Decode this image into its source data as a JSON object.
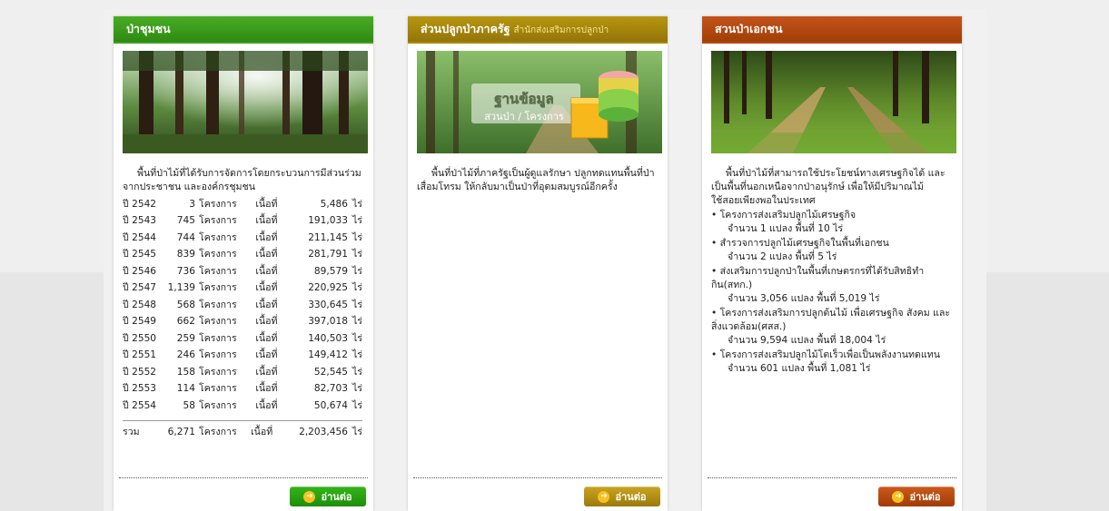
{
  "colors": {
    "community_green": "#3c9a1c",
    "state_gold": "#a8860f",
    "private_rust": "#b3480d"
  },
  "cards": [
    {
      "title": "ป่าชุมชน",
      "image_icon": "forest-photo",
      "description": "พื้นที่ป่าไม้ที่ได้รับการจัดการโดยกระบวนการมีส่วนร่วมจากประชาชน และองค์กรชุมชน",
      "rows": [
        {
          "year": "ปี 2542",
          "count": "3",
          "proj": "โครงการ",
          "area_label": "เนื้อที่",
          "area": "5,486",
          "unit": "ไร่"
        },
        {
          "year": "ปี 2543",
          "count": "745",
          "proj": "โครงการ",
          "area_label": "เนื้อที่",
          "area": "191,033",
          "unit": "ไร่"
        },
        {
          "year": "ปี 2544",
          "count": "744",
          "proj": "โครงการ",
          "area_label": "เนื้อที่",
          "area": "211,145",
          "unit": "ไร่"
        },
        {
          "year": "ปี 2545",
          "count": "839",
          "proj": "โครงการ",
          "area_label": "เนื้อที่",
          "area": "281,791",
          "unit": "ไร่"
        },
        {
          "year": "ปี 2546",
          "count": "736",
          "proj": "โครงการ",
          "area_label": "เนื้อที่",
          "area": "89,579",
          "unit": "ไร่"
        },
        {
          "year": "ปี 2547",
          "count": "1,139",
          "proj": "โครงการ",
          "area_label": "เนื้อที่",
          "area": "220,925",
          "unit": "ไร่"
        },
        {
          "year": "ปี 2548",
          "count": "568",
          "proj": "โครงการ",
          "area_label": "เนื้อที่",
          "area": "330,645",
          "unit": "ไร่"
        },
        {
          "year": "ปี 2549",
          "count": "662",
          "proj": "โครงการ",
          "area_label": "เนื้อที่",
          "area": "397,018",
          "unit": "ไร่"
        },
        {
          "year": "ปี 2550",
          "count": "259",
          "proj": "โครงการ",
          "area_label": "เนื้อที่",
          "area": "140,503",
          "unit": "ไร่"
        },
        {
          "year": "ปี 2551",
          "count": "246",
          "proj": "โครงการ",
          "area_label": "เนื้อที่",
          "area": "149,412",
          "unit": "ไร่"
        },
        {
          "year": "ปี 2552",
          "count": "158",
          "proj": "โครงการ",
          "area_label": "เนื้อที่",
          "area": "52,545",
          "unit": "ไร่"
        },
        {
          "year": "ปี 2553",
          "count": "114",
          "proj": "โครงการ",
          "area_label": "เนื้อที่",
          "area": "82,703",
          "unit": "ไร่"
        },
        {
          "year": "ปี 2554",
          "count": "58",
          "proj": "โครงการ",
          "area_label": "เนื้อที่",
          "area": "50,674",
          "unit": "ไร่"
        }
      ],
      "total": {
        "label": "รวม",
        "count": "6,271",
        "proj": "โครงการ",
        "area_label": "เนื้อที่",
        "area": "2,203,456",
        "unit": "ไร่"
      },
      "button": "อ่านต่อ"
    },
    {
      "title": "ส่วนปลูกป่าภาครัฐ",
      "subtitle": "สำนักส่งเสริมการปลูกป่า",
      "image_icon": "database-forest-photo",
      "image_text_1": "ฐานข้อมูล",
      "image_text_2": "สวนป่า / โครงการ",
      "description": "พื้นที่ป่าไม้ที่ภาครัฐเป็นผู้ดูแลรักษา ปลูกทดแทนพื้นที่ป่าเสื่อมโทรม ให้กลับมาเป็นป่าที่อุดมสมบูรณ์อีกครั้ง",
      "button": "อ่านต่อ"
    },
    {
      "title": "สวนป่าเอกชน",
      "image_icon": "forest-path-photo",
      "description": "พื้นที่ป่าไม้ที่สามารถใช้ประโยชน์ทางเศรษฐกิจได้ และเป็นพื้นที่นอกเหนือจากป่าอนุรักษ์ เพื่อให้มีปริมาณไม้ใช้สอยเพียงพอในประเทศ",
      "items": [
        {
          "line1": "• โครงการส่งเสริมปลูกไม้เศรษฐกิจ",
          "line2": "จำนวน 1 แปลง พื้นที่ 10 ไร่"
        },
        {
          "line1": "• สำรวจการปลูกไม้เศรษฐกิจในพื้นที่เอกชน",
          "line2": "จำนวน 2 แปลง พื้นที่ 5 ไร่"
        },
        {
          "line1": "• ส่งเสริมการปลูกป่าในพื้นที่เกษตรกรที่ได้รับสิทธิทำกิน(สทก.)",
          "line2": "จำนวน 3,056 แปลง พื้นที่ 5,019 ไร่"
        },
        {
          "line1": "• โครงการส่งเสริมการปลูกต้นไม้ เพื่อเศรษฐกิจ สังคม และสิ่งแวดล้อม(ศสส.)",
          "line2": "จำนวน 9,594 แปลง พื้นที่ 18,004 ไร่"
        },
        {
          "line1": "• โครงการส่งเสริมปลูกไม้โตเร็วเพื่อเป็นพลังงานทดแทน",
          "line2": "จำนวน 601 แปลง พื้นที่ 1,081 ไร่"
        }
      ],
      "button": "อ่านต่อ"
    }
  ]
}
